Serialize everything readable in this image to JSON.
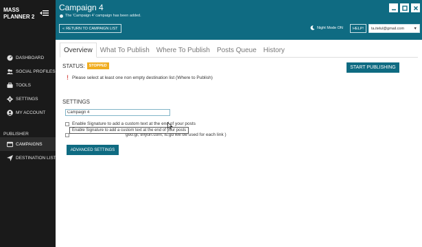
{
  "sidebar": {
    "brand_line1": "MASS",
    "brand_line2": "PLANNER 2",
    "items": [
      {
        "label": "DASHBOARD",
        "icon": "dashboard-icon"
      },
      {
        "label": "SOCIAL PROFILES",
        "icon": "social-profiles-icon"
      },
      {
        "label": "TOOLS",
        "icon": "tools-icon"
      },
      {
        "label": "SETTINGS",
        "icon": "gear-icon"
      },
      {
        "label": "MY ACCOUNT",
        "icon": "user-icon"
      }
    ],
    "section_label": "PUBLISHER",
    "publisher_items": [
      {
        "label": "CAMPAIGNS",
        "icon": "campaigns-icon",
        "active": true
      },
      {
        "label": "DESTINATION LISTS",
        "icon": "send-icon",
        "active": false
      }
    ]
  },
  "header": {
    "title": "Campaign 4",
    "subtitle": "The 'Campaign 4' campaign has been added.",
    "return_label": "RETURN TO CAMPAIGN LIST",
    "night_mode": "Night Mode ON",
    "help_label": "HELP!",
    "account": "ta.itelul@gmail.com"
  },
  "tabs": [
    "Overview",
    "What To Publish",
    "Where To Publish",
    "Posts Queue",
    "History"
  ],
  "status": {
    "label": "STATUS:",
    "value": "STOPPED",
    "start_button": "START PUBLISHING",
    "warning": "Please select at least one non empty destination list (Where to Publish)"
  },
  "settings": {
    "title": "SETTINGS",
    "campaign_name": "Campaign 4",
    "signature_label": "Enable Signature to add a custom text at the end of your posts",
    "tooltip": "Enable Signature to add a custom text at the end of your posts",
    "shorten_label": "goo.gl, tinyurl.com, is.gd will be used for each link )",
    "advanced_button": "ADVANCED SETTINGS"
  },
  "colors": {
    "teal": "#0f6b82",
    "sidebar": "#1a1a1a",
    "badge": "#f0ad1f"
  }
}
